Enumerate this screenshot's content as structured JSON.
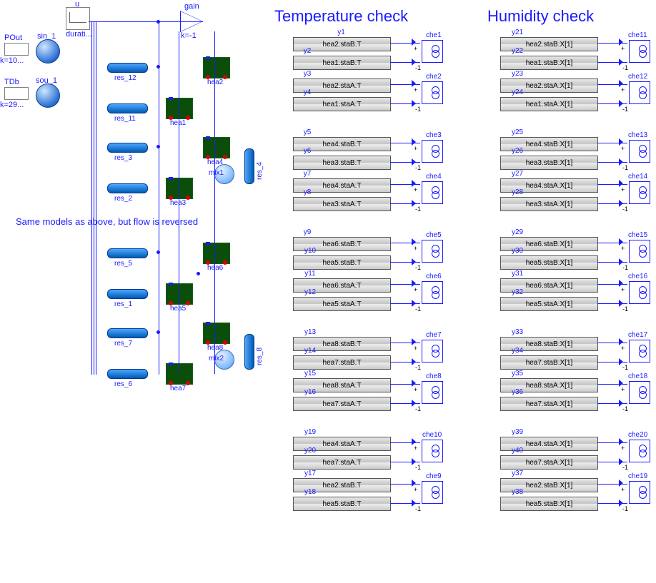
{
  "headings": {
    "temp": "Temperature check",
    "humid": "Humidity check"
  },
  "note": "Same models as above, but flow is reversed",
  "sources": {
    "u": {
      "lbl": "u",
      "sub": "durati..."
    },
    "pout": {
      "lbl": "POut",
      "sub": "k=10..."
    },
    "tdb": {
      "lbl": "TDb",
      "sub": "k=29..."
    },
    "sin1": "sin_1",
    "sou1": "sou_1"
  },
  "gain": {
    "lbl": "gain",
    "sub": "k=-1"
  },
  "res": {
    "r12": "res_12",
    "r11": "res_11",
    "r3": "res_3",
    "r2": "res_2",
    "r4": "res_4",
    "r5": "res_5",
    "r1": "res_1",
    "r7": "res_7",
    "r6": "res_6",
    "r8": "res_8"
  },
  "hea": {
    "h1": "hea1",
    "h2": "hea2",
    "h3": "hea3",
    "h4": "hea4",
    "h5": "hea5",
    "h6": "hea6",
    "h7": "hea7",
    "h8": "hea8"
  },
  "mix": {
    "m1": "mix1",
    "m2": "mix2"
  },
  "temp": {
    "y1": {
      "lbl": "y1",
      "expr": "hea2.staB.T"
    },
    "y2": {
      "lbl": "y2",
      "expr": "hea1.staB.T"
    },
    "y3": {
      "lbl": "y3",
      "expr": "hea2.staA.T"
    },
    "y4": {
      "lbl": "y4",
      "expr": "hea1.staA.T"
    },
    "y5": {
      "lbl": "y5",
      "expr": "hea4.staB.T"
    },
    "y6": {
      "lbl": "y6",
      "expr": "hea3.staB.T"
    },
    "y7": {
      "lbl": "y7",
      "expr": "hea4.staA.T"
    },
    "y8": {
      "lbl": "y8",
      "expr": "hea3.staA.T"
    },
    "y9": {
      "lbl": "y9",
      "expr": "hea6.staB.T"
    },
    "y10": {
      "lbl": "y10",
      "expr": "hea5.staB.T"
    },
    "y11": {
      "lbl": "y11",
      "expr": "hea6.staA.T"
    },
    "y12": {
      "lbl": "y12",
      "expr": "hea5.staA.T"
    },
    "y13": {
      "lbl": "y13",
      "expr": "hea8.staB.T"
    },
    "y14": {
      "lbl": "y14",
      "expr": "hea7.staB.T"
    },
    "y15": {
      "lbl": "y15",
      "expr": "hea8.staA.T"
    },
    "y16": {
      "lbl": "y16",
      "expr": "hea7.staA.T"
    },
    "y17": {
      "lbl": "y17",
      "expr": "hea2.staB.T"
    },
    "y18": {
      "lbl": "y18",
      "expr": "hea5.staB.T"
    },
    "y19": {
      "lbl": "y19",
      "expr": "hea4.staA.T"
    },
    "y20": {
      "lbl": "y20",
      "expr": "hea7.staA.T"
    }
  },
  "humid": {
    "y21": {
      "lbl": "y21",
      "expr": "hea2.staB.X[1]"
    },
    "y22": {
      "lbl": "y22",
      "expr": "hea1.staB.X[1]"
    },
    "y23": {
      "lbl": "y23",
      "expr": "hea2.staA.X[1]"
    },
    "y24": {
      "lbl": "y24",
      "expr": "hea1.staA.X[1]"
    },
    "y25": {
      "lbl": "y25",
      "expr": "hea4.staB.X[1]"
    },
    "y26": {
      "lbl": "y26",
      "expr": "hea3.staB.X[1]"
    },
    "y27": {
      "lbl": "y27",
      "expr": "hea4.staA.X[1]"
    },
    "y28": {
      "lbl": "y28",
      "expr": "hea3.staA.X[1]"
    },
    "y29": {
      "lbl": "y29",
      "expr": "hea6.staB.X[1]"
    },
    "y30": {
      "lbl": "y30",
      "expr": "hea5.staB.X[1]"
    },
    "y31": {
      "lbl": "y31",
      "expr": "hea6.staA.X[1]"
    },
    "y32": {
      "lbl": "y32",
      "expr": "hea5.staA.X[1]"
    },
    "y33": {
      "lbl": "y33",
      "expr": "hea8.staB.X[1]"
    },
    "y34": {
      "lbl": "y34",
      "expr": "hea7.staB.X[1]"
    },
    "y35": {
      "lbl": "y35",
      "expr": "hea8.staA.X[1]"
    },
    "y36": {
      "lbl": "y36",
      "expr": "hea7.staA.X[1]"
    },
    "y37": {
      "lbl": "y37",
      "expr": "hea2.staB.X[1]"
    },
    "y38": {
      "lbl": "y38",
      "expr": "hea5.staB.X[1]"
    },
    "y39": {
      "lbl": "y39",
      "expr": "hea4.staA.X[1]"
    },
    "y40": {
      "lbl": "y40",
      "expr": "hea7.staA.X[1]"
    }
  },
  "checks": {
    "c1": "che1",
    "c2": "che2",
    "c3": "che3",
    "c4": "che4",
    "c5": "che5",
    "c6": "che6",
    "c7": "che7",
    "c8": "che8",
    "c9": "che9",
    "c10": "che10",
    "c11": "che11",
    "c12": "che12",
    "c13": "che13",
    "c14": "che14",
    "c15": "che15",
    "c16": "che16",
    "c17": "che17",
    "c18": "che18",
    "c19": "che19",
    "c20": "che20"
  }
}
